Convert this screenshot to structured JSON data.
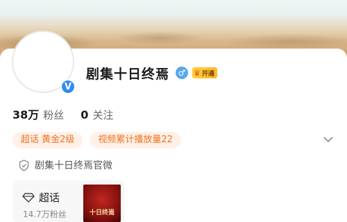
{
  "profile": {
    "name": "剧集十日终焉",
    "vip_label": "开通",
    "followers_count": "38万",
    "followers_label": "粉丝",
    "following_count": "0",
    "following_label": "关注"
  },
  "tags": [
    {
      "label": "超话 黄金2级"
    },
    {
      "label": "视频累计播放量22"
    }
  ],
  "official": {
    "text": "剧集十日终焉官微"
  },
  "super_topic": {
    "title": "超话",
    "fans": "14.7万粉丝",
    "poster_text": "十日终焉"
  },
  "colors": {
    "accent_orange": "#f07020",
    "verify_blue": "#2f8cf0",
    "tag_bg": "#fff1e8"
  },
  "icons": {
    "verify": "verified-v-icon",
    "gender": "male-icon",
    "vip": "crown-icon",
    "expand": "chevron-down-icon",
    "official": "shield-icon",
    "super_topic": "diamond-icon"
  }
}
